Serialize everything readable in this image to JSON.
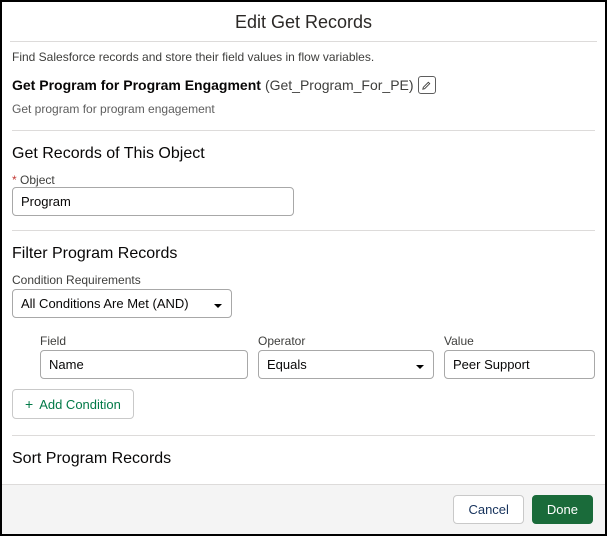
{
  "header": {
    "title": "Edit Get Records"
  },
  "intro": "Find Salesforce records and store their field values in flow variables.",
  "element": {
    "label": "Get Program for Program Engagment",
    "apiName": "(Get_Program_For_PE)",
    "description": "Get program for program engagement"
  },
  "sections": {
    "objectTitle": "Get Records of This Object",
    "objectLabel": "Object",
    "objectValue": "Program",
    "filterTitle": "Filter Program Records",
    "conditionReqLabel": "Condition Requirements",
    "conditionReqValue": "All Conditions Are Met (AND)",
    "filter": {
      "fieldLabel": "Field",
      "fieldValue": "Name",
      "operatorLabel": "Operator",
      "operatorValue": "Equals",
      "valueLabel": "Value",
      "valueValue": "Peer Support"
    },
    "addCondition": "Add Condition",
    "sortTitle": "Sort Program Records"
  },
  "footer": {
    "cancel": "Cancel",
    "done": "Done"
  }
}
